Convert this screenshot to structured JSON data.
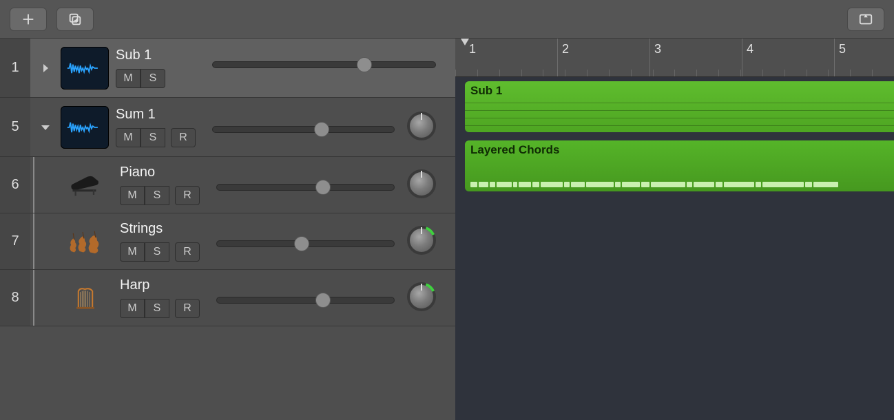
{
  "ruler": {
    "bars": [
      "1",
      "2",
      "3",
      "4",
      "5"
    ]
  },
  "tracks": [
    {
      "num": "1",
      "name": "Sub 1",
      "buttons": [
        "M",
        "S"
      ],
      "hasR": false,
      "volPct": 68,
      "hasPan": false,
      "selected": true,
      "icon": "wave",
      "disclosure": "right"
    },
    {
      "num": "5",
      "name": "Sum 1",
      "buttons": [
        "M",
        "S"
      ],
      "hasR": true,
      "volPct": 60,
      "hasPan": true,
      "panGreen": false,
      "icon": "wave",
      "disclosure": "down"
    },
    {
      "num": "6",
      "name": "Piano",
      "buttons": [
        "M",
        "S"
      ],
      "hasR": true,
      "volPct": 60,
      "hasPan": true,
      "panGreen": false,
      "icon": "piano",
      "sub": true
    },
    {
      "num": "7",
      "name": "Strings",
      "buttons": [
        "M",
        "S"
      ],
      "hasR": true,
      "volPct": 48,
      "hasPan": true,
      "panGreen": true,
      "icon": "strings",
      "sub": true
    },
    {
      "num": "8",
      "name": "Harp",
      "buttons": [
        "M",
        "S"
      ],
      "hasR": true,
      "volPct": 60,
      "hasPan": true,
      "panGreen": true,
      "icon": "harp",
      "sub": true
    }
  ],
  "regions": {
    "r1": {
      "label": "Sub 1"
    },
    "r2": {
      "label": "Layered Chords"
    }
  },
  "buttons": {
    "R": "R"
  }
}
